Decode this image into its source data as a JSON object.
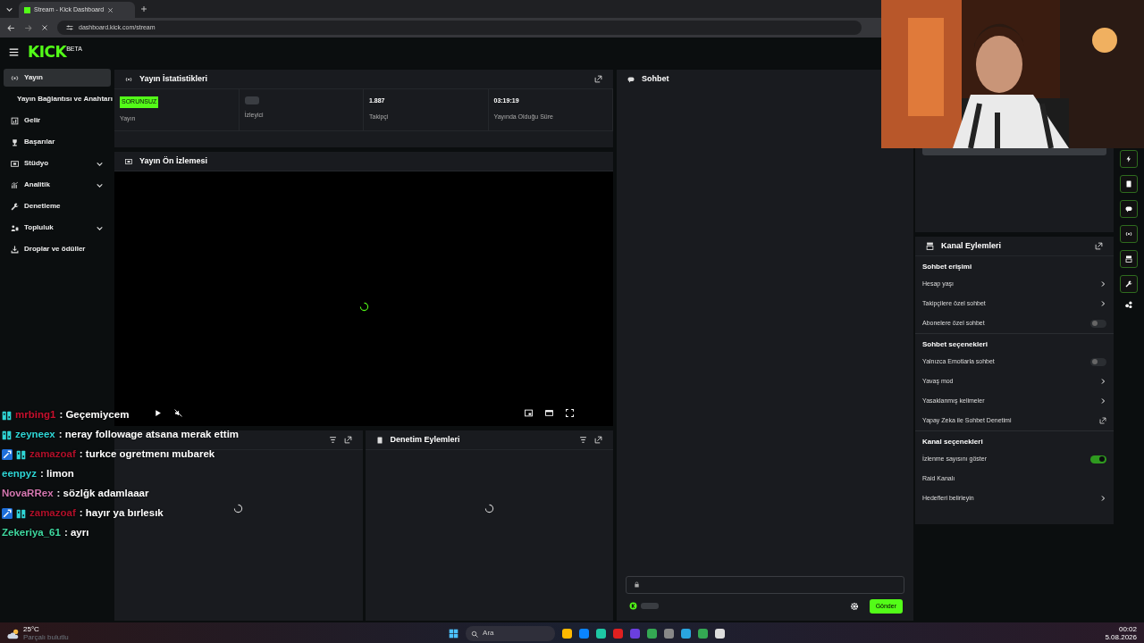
{
  "browser": {
    "tab_title": "Stream - Kick Dashboard",
    "url": "dashboard.kick.com/stream"
  },
  "logo": {
    "text": "KICK",
    "tag": "BETA"
  },
  "sidebar": {
    "items": [
      {
        "label": "Yayın",
        "selected": true,
        "expandable": false,
        "sub": false
      },
      {
        "label": "Yayın Bağlantısı ve Anahtarı",
        "selected": false,
        "expandable": false,
        "sub": true
      },
      {
        "label": "Gelir",
        "selected": false,
        "expandable": false,
        "sub": false
      },
      {
        "label": "Başarılar",
        "selected": false,
        "expandable": false,
        "sub": false
      },
      {
        "label": "Stüdyo",
        "selected": false,
        "expandable": true,
        "sub": false
      },
      {
        "label": "Analitik",
        "selected": false,
        "expandable": true,
        "sub": false
      },
      {
        "label": "Denetleme",
        "selected": false,
        "expandable": false,
        "sub": false
      },
      {
        "label": "Topluluk",
        "selected": false,
        "expandable": true,
        "sub": false
      },
      {
        "label": "Droplar ve ödüller",
        "selected": false,
        "expandable": false,
        "sub": false
      }
    ]
  },
  "stats": {
    "title": "Yayın İstatistikleri",
    "items": [
      {
        "kind": "badge",
        "value": "SORUNSUZ",
        "label": "Yayın"
      },
      {
        "kind": "loading",
        "label": "İzleyici"
      },
      {
        "kind": "text",
        "value": "1.887",
        "label": "Takipçi"
      },
      {
        "kind": "text",
        "value": "03:19:19",
        "label": "Yayında Olduğu Süre"
      }
    ]
  },
  "preview": {
    "title": "Yayın Ön İzlemesi"
  },
  "moderation": {
    "title": "Denetim Eylemleri"
  },
  "chat": {
    "title": "Sohbet",
    "send": "Gönder"
  },
  "channel_actions": {
    "title": "Kanal Eylemleri",
    "sections": [
      {
        "heading": "Sohbet erişimi",
        "rows": [
          {
            "kind": "arrow",
            "label": "Hesap yaşı"
          },
          {
            "kind": "arrow",
            "label": "Takipçilere özel sohbet"
          },
          {
            "kind": "toggle",
            "label": "Abonelere özel sohbet",
            "on": false
          }
        ]
      },
      {
        "heading": "Sohbet seçenekleri",
        "rows": [
          {
            "kind": "toggle",
            "label": "Yalnızca Emotlarla sohbet",
            "on": false
          },
          {
            "kind": "arrow",
            "label": "Yavaş mod"
          },
          {
            "kind": "arrow",
            "label": "Yasaklanmış kelimeler"
          },
          {
            "kind": "external",
            "label": "Yapay Zeka ile Sohbet Denetimi"
          }
        ]
      },
      {
        "heading": "Kanal seçenekleri",
        "rows": [
          {
            "kind": "toggle",
            "label": "İzlenme sayısını göster",
            "on": true
          },
          {
            "kind": "plain",
            "label": "Raid Kanalı"
          },
          {
            "kind": "arrow",
            "label": "Hedefleri belirleyin"
          }
        ]
      }
    ]
  },
  "stream_chat_overlay": [
    {
      "mod": false,
      "sub": true,
      "name": "mrbing1",
      "color": "#c8102e",
      "message": ": Geçemiycem"
    },
    {
      "mod": false,
      "sub": true,
      "name": "zeyneex",
      "color": "#2fd6d6",
      "message": ": neray followage atsana merak ettim"
    },
    {
      "mod": true,
      "sub": true,
      "name": "zamazoaf",
      "color": "#b0102a",
      "message": ": turkce ogretmenı mubarek"
    },
    {
      "mod": false,
      "sub": false,
      "name": "eenpyz",
      "color": "#2fd6d6",
      "message": ": limon"
    },
    {
      "mod": false,
      "sub": false,
      "name": "NovaRRex",
      "color": "#d477b0",
      "message": ": sözlğk adamlaaar"
    },
    {
      "mod": true,
      "sub": true,
      "name": "zamazoaf",
      "color": "#b0102a",
      "message": ": hayır ya bırlesık"
    },
    {
      "mod": false,
      "sub": false,
      "name": "Zekeriya_61",
      "color": "#3fd9a0",
      "message": ": ayrı"
    }
  ],
  "taskbar": {
    "temperature": "25°C",
    "weather": "Parçalı bulutlu",
    "search": "Ara",
    "time": "00:02",
    "date": "5.08.2026"
  }
}
